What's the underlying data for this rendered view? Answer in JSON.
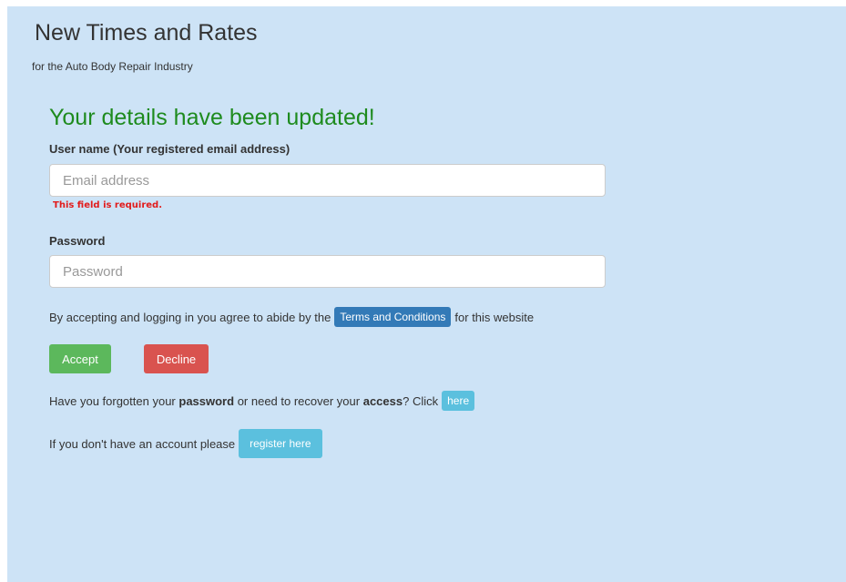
{
  "header": {
    "title": "New Times and Rates",
    "subtitle": "for the Auto Body Repair Industry"
  },
  "form": {
    "success_message": "Your details have been updated!",
    "username_label": "User name (Your registered email address)",
    "email_placeholder": "Email address",
    "email_value": "",
    "email_error": "This field is required.",
    "password_label": "Password",
    "password_placeholder": "Password",
    "password_value": ""
  },
  "terms": {
    "prefix": "By accepting and logging in you agree to abide by the",
    "link_label": "Terms and Conditions",
    "suffix": "for this website"
  },
  "actions": {
    "accept_label": "Accept",
    "decline_label": "Decline"
  },
  "recovery": {
    "text_1": "Have you forgotten your",
    "bold_1": "password",
    "text_2": "or need to recover your",
    "bold_2": "access",
    "text_3": "? Click",
    "link_label": "here"
  },
  "register": {
    "text": "If you don't have an account please",
    "button_label": "register here"
  },
  "colors": {
    "panel_background": "#cde3f6",
    "success_green": "#1e8b1e",
    "error_red": "#e21b1b",
    "accept_green": "#5cb85c",
    "decline_red": "#d9534f",
    "primary_blue": "#337ab7",
    "info_blue": "#5bc0de"
  }
}
